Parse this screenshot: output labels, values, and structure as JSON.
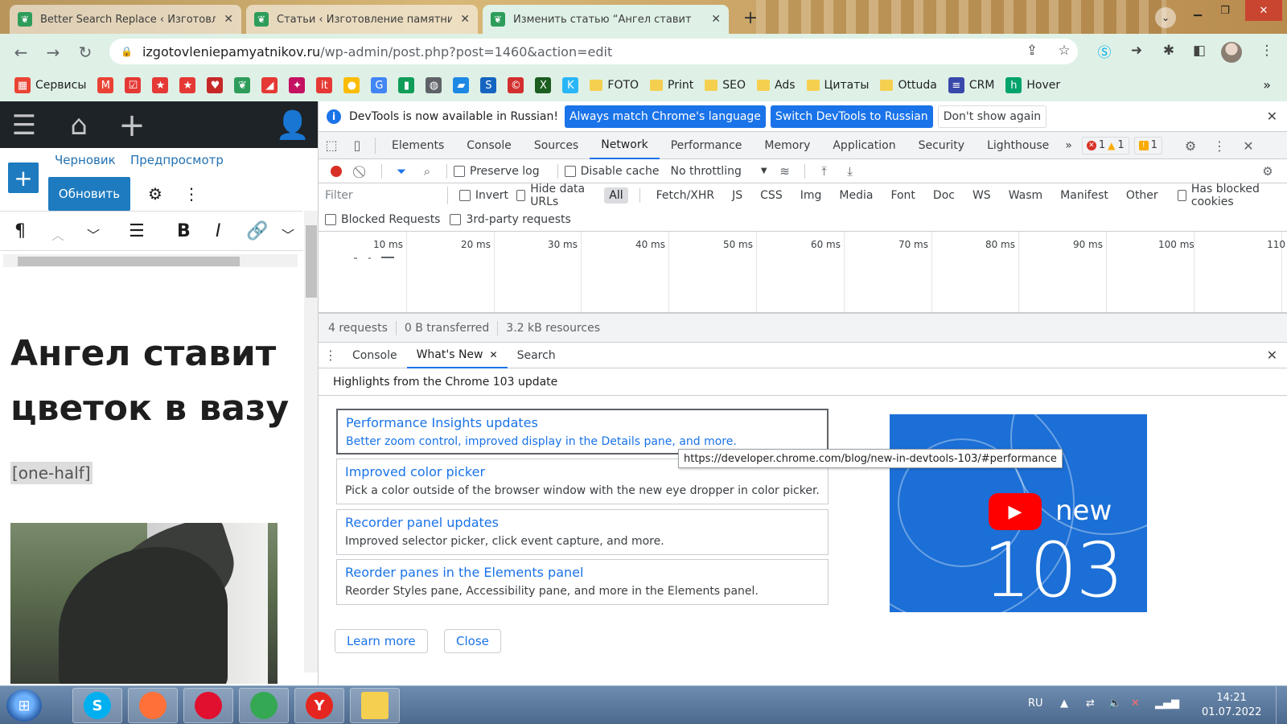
{
  "browser": {
    "tabs": [
      {
        "title": "Better Search Replace ‹ Изготовл",
        "active": false
      },
      {
        "title": "Статьи ‹ Изготовление памятни",
        "active": false
      },
      {
        "title": "Изменить статью “Ангел ставит",
        "active": true
      }
    ],
    "tab_close_glyph": "✕",
    "new_tab_glyph": "+",
    "address": {
      "host": "izgotovleniepamyatnikov.ru",
      "path": "/wp-admin/post.php?post=1460&action=edit"
    },
    "bookmarks": [
      {
        "label": "Сервисы",
        "icon": "apps-grid-icon",
        "color": "#ea4335"
      },
      {
        "label": "",
        "icon": "gmail-icon",
        "color": "#ea4335"
      },
      {
        "label": "",
        "icon": "todo-check-icon",
        "color": "#e53935"
      },
      {
        "label": "",
        "icon": "star-red-icon",
        "color": "#e53935"
      },
      {
        "label": "",
        "icon": "star-red-icon",
        "color": "#e53935"
      },
      {
        "label": "",
        "icon": "heart-icon",
        "color": "#c62828"
      },
      {
        "label": "",
        "icon": "leaf-icon",
        "color": "#2e9d5b"
      },
      {
        "label": "",
        "icon": "slash-icon",
        "color": "#e53935"
      },
      {
        "label": "",
        "icon": "sparkle-icon",
        "color": "#c51162"
      },
      {
        "label": "",
        "icon": "it-icon",
        "color": "#e53935"
      },
      {
        "label": "",
        "icon": "circle-multicolor-icon",
        "color": "#fbbc04"
      },
      {
        "label": "",
        "icon": "translate-icon",
        "color": "#4285f4"
      },
      {
        "label": "",
        "icon": "bars-green-icon",
        "color": "#0f9d58"
      },
      {
        "label": "",
        "icon": "globe-icon",
        "color": "#5f6368"
      },
      {
        "label": "",
        "icon": "book-icon",
        "color": "#1e88e5"
      },
      {
        "label": "",
        "icon": "s-script-icon",
        "color": "#1565c0"
      },
      {
        "label": "",
        "icon": "c-circle-icon",
        "color": "#d32f2f"
      },
      {
        "label": "",
        "icon": "x-green-icon",
        "color": "#1b5e20"
      },
      {
        "label": "",
        "icon": "k-icon",
        "color": "#29b6f6"
      },
      {
        "label": "FOTO",
        "icon": "folder-icon",
        "color": "#f5cf4f"
      },
      {
        "label": "Print",
        "icon": "folder-icon",
        "color": "#f5cf4f"
      },
      {
        "label": "SEO",
        "icon": "folder-icon",
        "color": "#f5cf4f"
      },
      {
        "label": "Ads",
        "icon": "folder-icon",
        "color": "#f5cf4f"
      },
      {
        "label": "Цитаты",
        "icon": "folder-icon",
        "color": "#f5cf4f"
      },
      {
        "label": "Ottuda",
        "icon": "folder-icon",
        "color": "#f5cf4f"
      },
      {
        "label": "CRM",
        "icon": "stack-icon",
        "color": "#3949ab"
      },
      {
        "label": "Hover",
        "icon": "h-icon",
        "color": "#00a36c"
      }
    ],
    "bookmarks_more": "»"
  },
  "wordpress": {
    "draft_link": "Черновик",
    "preview_link": "Предпросмотр",
    "update_button": "Обновить",
    "post_title": "Ангел ставит цветок в вазу",
    "shortcode": "[one-half]"
  },
  "devtools": {
    "infobar": {
      "message": "DevTools is now available in Russian!",
      "btn_match": "Always match Chrome's language",
      "btn_switch": "Switch DevTools to Russian",
      "btn_dismiss": "Don't show again"
    },
    "panels": [
      "Elements",
      "Console",
      "Sources",
      "Network",
      "Performance",
      "Memory",
      "Application",
      "Security",
      "Lighthouse"
    ],
    "active_panel": "Network",
    "more_panels": "»",
    "errors": "1",
    "warnings": "1",
    "issues": "1",
    "network": {
      "preserve_log": "Preserve log",
      "disable_cache": "Disable cache",
      "throttling": "No throttling",
      "filter_placeholder": "Filter",
      "invert": "Invert",
      "hide_data_urls": "Hide data URLs",
      "types": [
        "All",
        "Fetch/XHR",
        "JS",
        "CSS",
        "Img",
        "Media",
        "Font",
        "Doc",
        "WS",
        "Wasm",
        "Manifest",
        "Other"
      ],
      "selected_type": "All",
      "has_blocked_cookies": "Has blocked cookies",
      "blocked_requests": "Blocked Requests",
      "third_party": "3rd-party requests",
      "timeline_ticks": [
        "10 ms",
        "20 ms",
        "30 ms",
        "40 ms",
        "50 ms",
        "60 ms",
        "70 ms",
        "80 ms",
        "90 ms",
        "100 ms",
        "110"
      ],
      "summary": {
        "requests": "4 requests",
        "transferred": "0 B transferred",
        "resources": "3.2 kB resources"
      }
    },
    "drawer": {
      "tabs": [
        "Console",
        "What's New",
        "Search"
      ],
      "active_tab": "What's New",
      "whats_new_header": "Highlights from the Chrome 103 update",
      "cards": [
        {
          "title": "Performance Insights updates",
          "desc": "Better zoom control, improved display in the Details pane, and more."
        },
        {
          "title": "Improved color picker",
          "desc": "Pick a color outside of the browser window with the new eye dropper in color picker."
        },
        {
          "title": "Recorder panel updates",
          "desc": "Improved selector picker, click event capture, and more."
        },
        {
          "title": "Reorder panes in the Elements panel",
          "desc": "Reorder Styles pane, Accessibility pane, and more in the Elements panel."
        }
      ],
      "tooltip_url": "https://developer.chrome.com/blog/new-in-devtools-103/#performance",
      "video_new": "new",
      "video_number": "103",
      "learn_more": "Learn more",
      "close": "Close"
    }
  },
  "taskbar": {
    "language": "RU",
    "time": "14:21",
    "date": "01.07.2022",
    "apps": [
      {
        "name": "skype",
        "glyph": "S",
        "color": "#00aff0"
      },
      {
        "name": "firefox",
        "glyph": "",
        "color": "#ff7139"
      },
      {
        "name": "opera",
        "glyph": "",
        "color": "#e0102e"
      },
      {
        "name": "chrome",
        "glyph": "",
        "color": "#34a853"
      },
      {
        "name": "yandex",
        "glyph": "Y",
        "color": "#e52620"
      },
      {
        "name": "explorer",
        "glyph": "",
        "color": "#f5cf4f"
      }
    ]
  },
  "colors": {
    "accent": "#1a73e8",
    "wp_blue": "#1e7bbf",
    "wp_admin_bar": "#1d2327",
    "error": "#d93025",
    "warning": "#f9ab00"
  }
}
